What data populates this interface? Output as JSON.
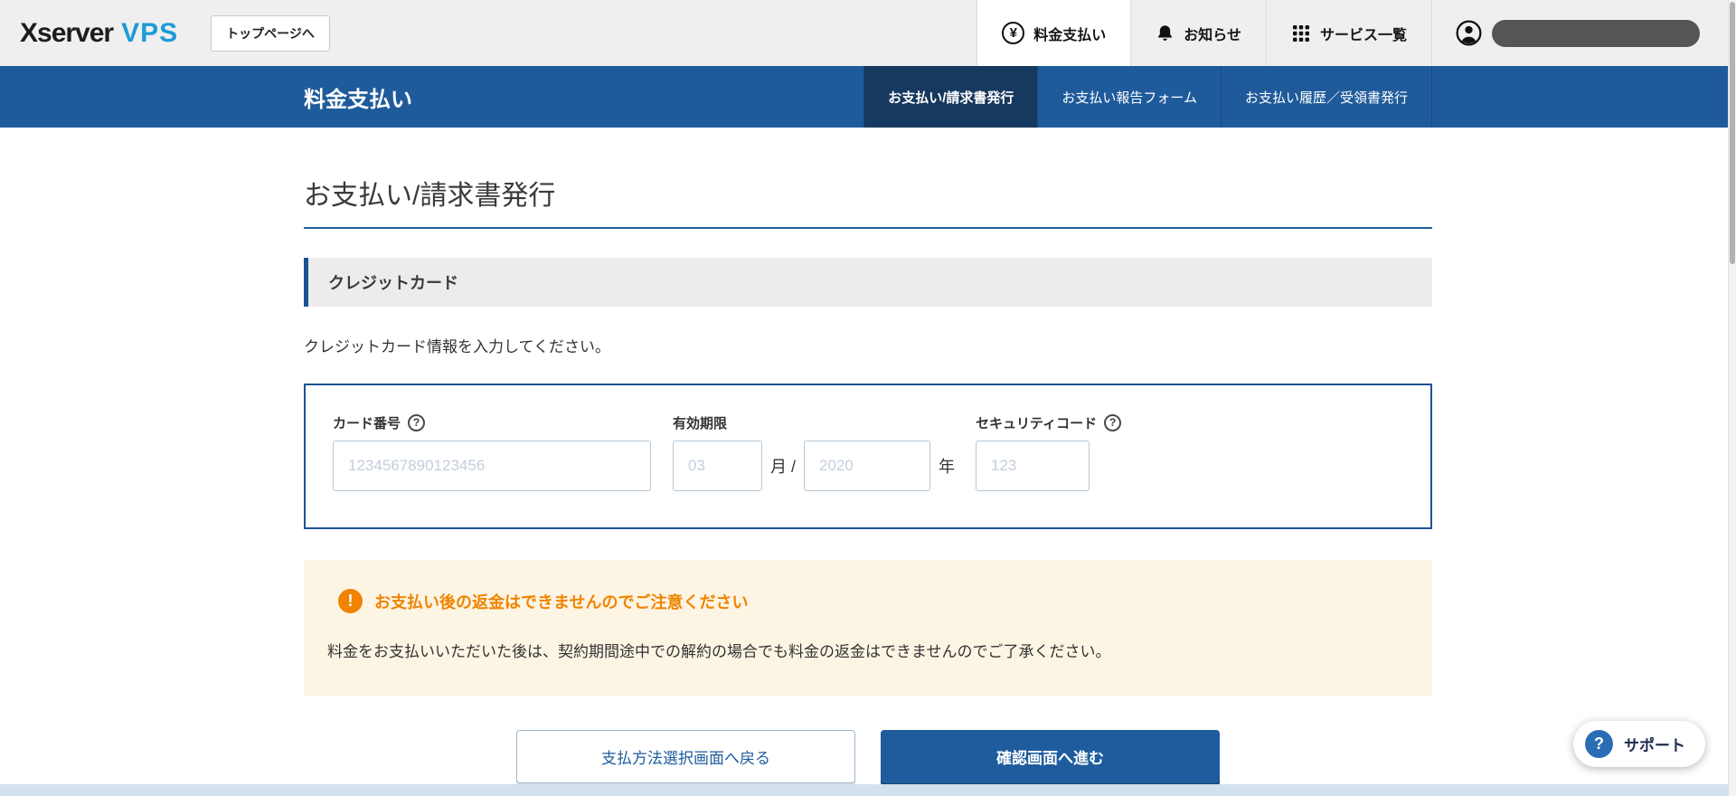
{
  "header": {
    "logo": {
      "part1": "Xserver",
      "part2": "VPS"
    },
    "top_page_button": "トップページへ",
    "nav": [
      {
        "label": "料金支払い",
        "icon": "yen-circle-icon",
        "active": true
      },
      {
        "label": "お知らせ",
        "icon": "bell-icon",
        "active": false
      },
      {
        "label": "サービス一覧",
        "icon": "grid-icon",
        "active": false
      }
    ]
  },
  "subheader": {
    "title": "料金支払い",
    "tabs": [
      {
        "label": "お支払い/請求書発行",
        "active": true
      },
      {
        "label": "お支払い報告フォーム",
        "active": false
      },
      {
        "label": "お支払い履歴／受領書発行",
        "active": false
      }
    ]
  },
  "main": {
    "page_title": "お支払い/請求書発行",
    "section_title": "クレジットカード",
    "instruction": "クレジットカード情報を入力してください。",
    "form": {
      "card_number": {
        "label": "カード番号",
        "placeholder": "1234567890123456",
        "value": ""
      },
      "expiry": {
        "label": "有効期限",
        "month_placeholder": "03",
        "month_suffix": "月 /",
        "year_placeholder": "2020",
        "year_suffix": "年"
      },
      "security_code": {
        "label": "セキュリティコード",
        "placeholder": "123",
        "value": ""
      }
    },
    "notice": {
      "title": "お支払い後の返金はできませんのでご注意ください",
      "body": "料金をお支払いいただいた後は、契約期間途中での解約の場合でも料金の返金はできませんのでご了承ください。"
    },
    "actions": {
      "back": "支払方法選択画面へ戻る",
      "proceed": "確認画面へ進む"
    }
  },
  "support": {
    "label": "サポート",
    "icon": "question-circle-icon"
  },
  "icons": {
    "yen": "¥",
    "question": "?",
    "exclamation": "!"
  },
  "colors": {
    "brand_blue": "#1f5b9b",
    "active_tab_blue": "#16395f",
    "logo_blue": "#1e9bd7",
    "warning_orange": "#f08300",
    "notice_bg": "#fdf5e4",
    "topbar_gray": "#efefef"
  }
}
